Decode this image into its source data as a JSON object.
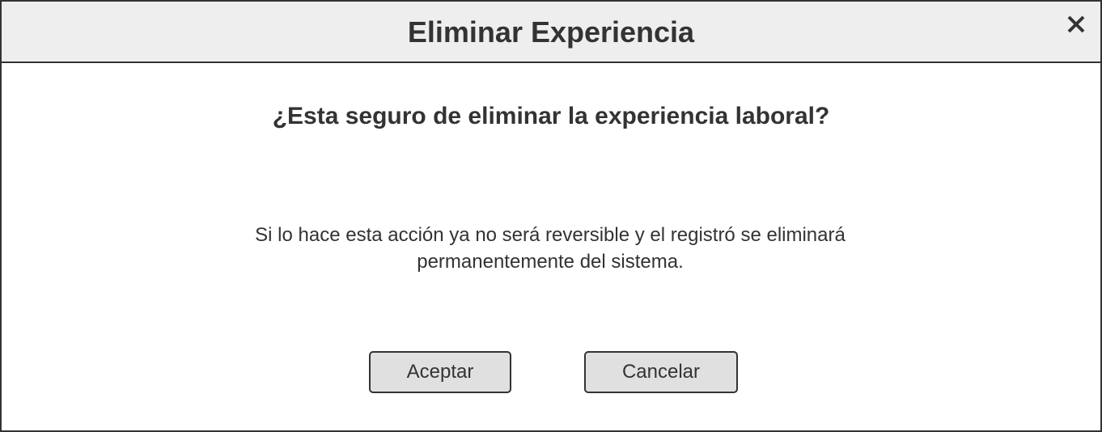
{
  "dialog": {
    "title": "Eliminar Experiencia",
    "close_icon": "close-icon",
    "question": "¿Esta seguro de eliminar la experiencia laboral?",
    "message": "Si lo hace esta acción ya no será reversible y el registró se eliminará permanentemente del sistema.",
    "accept_label": "Aceptar",
    "cancel_label": "Cancelar"
  },
  "colors": {
    "header_background": "#eeeeee",
    "border": "#333333",
    "text": "#333333",
    "button_background": "#e0e0e0"
  }
}
